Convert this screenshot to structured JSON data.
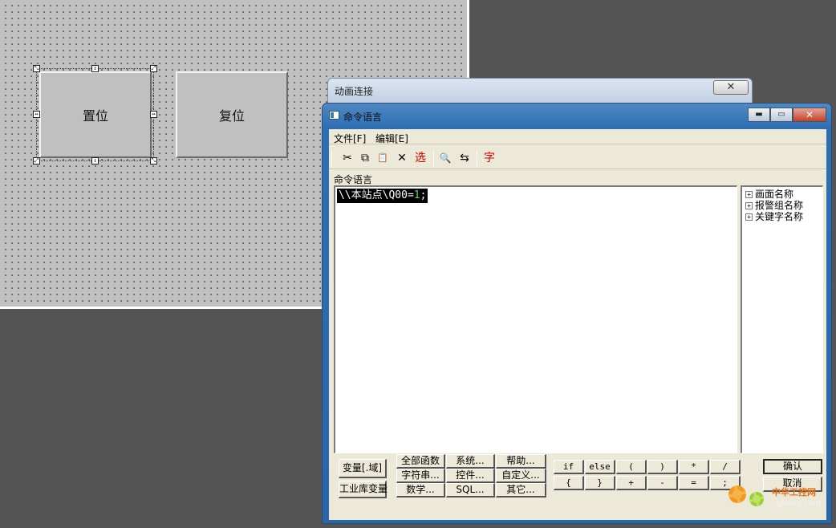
{
  "canvas": {
    "buttons": [
      {
        "label": "置位"
      },
      {
        "label": "复位"
      }
    ]
  },
  "dialog_back": {
    "title": "动画连接",
    "close": "✕"
  },
  "window": {
    "title": "命令语言",
    "caption_buttons": {
      "minimize": "▬",
      "maximize": "▭",
      "close": "✕"
    },
    "menu": [
      "文件[F]",
      "编辑[E]"
    ],
    "toolbar": {
      "cut": "✂",
      "copy": "⧉",
      "paste": "📋",
      "delete": "✕",
      "select": "选",
      "find": "🔍",
      "replace": "⇆",
      "font": "字"
    },
    "editor_label": "命令语言",
    "code": {
      "text": "\\\\本站点\\Q00=",
      "value": "1",
      "end": ";"
    },
    "tree": [
      {
        "expander": "+",
        "label": "画面名称"
      },
      {
        "expander": "+",
        "label": "报警组名称"
      },
      {
        "expander": "+",
        "label": "关键字名称"
      }
    ],
    "buttons": {
      "var_field": "变量[.域]",
      "lib_var": "工业库变量",
      "all_funcs": "全部函数",
      "system": "系统...",
      "help": "帮助...",
      "string": "字符串...",
      "control": "控件...",
      "custom": "自定义...",
      "math": "数学...",
      "sql": "SQL...",
      "other": "其它...",
      "ops": [
        "if",
        "else",
        "(",
        ")",
        "*",
        "/",
        "{",
        "}",
        "+",
        "-",
        "=",
        ";"
      ],
      "ok": "确认",
      "cancel": "取消"
    }
  },
  "watermark": {
    "cn": "中华工控网",
    "url": "gkong.com"
  }
}
